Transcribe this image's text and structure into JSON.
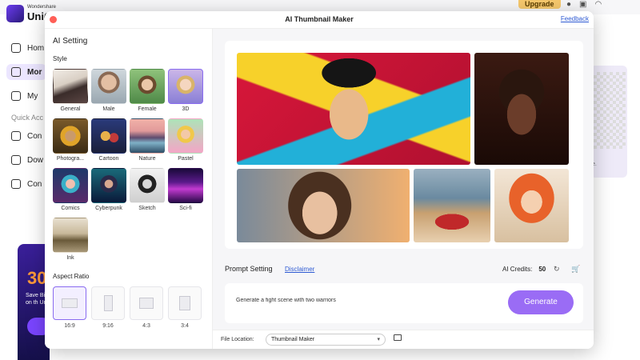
{
  "background": {
    "brand_small": "Wondershare",
    "brand": "UniC",
    "nav": [
      {
        "label": "Hom"
      },
      {
        "label": "Mor"
      },
      {
        "label": "My "
      },
      {
        "label": "Con"
      },
      {
        "label": "Dow"
      },
      {
        "label": "Con"
      }
    ],
    "quick_access": "Quick Acc",
    "promo_big": "30",
    "promo_small": "Save Bi on th Un",
    "upgrade_label": "Upgrade",
    "right_card_caption": "e."
  },
  "window": {
    "title": "AI Thumbnail Maker",
    "feedback_label": "Feedback"
  },
  "left": {
    "ai_setting": "AI Setting",
    "style_title": "Style",
    "styles": [
      {
        "label": "General"
      },
      {
        "label": "Male"
      },
      {
        "label": "Female"
      },
      {
        "label": "3D"
      },
      {
        "label": "Photogra..."
      },
      {
        "label": "Cartoon"
      },
      {
        "label": "Nature"
      },
      {
        "label": "Pastel"
      },
      {
        "label": "Comics"
      },
      {
        "label": "Cyberpunk"
      },
      {
        "label": "Sketch"
      },
      {
        "label": "Sci-fi"
      },
      {
        "label": "Ink"
      }
    ],
    "selected_style": "3D",
    "aspect_title": "Aspect Ratio",
    "ratios": [
      {
        "label": "16:9"
      },
      {
        "label": "9:16"
      },
      {
        "label": "4:3"
      },
      {
        "label": "3:4"
      }
    ],
    "selected_ratio": "16:9"
  },
  "right": {
    "prompt_title": "Prompt Setting",
    "disclaimer": "Disclaimer",
    "credits_label": "AI Credits:",
    "credits_value": "50",
    "prompt_text": "Generate a fight scene with two warriors",
    "generate_label": "Generate"
  },
  "footer": {
    "file_location_label": "File Location:",
    "file_location_value": "Thumbnail Maker"
  }
}
